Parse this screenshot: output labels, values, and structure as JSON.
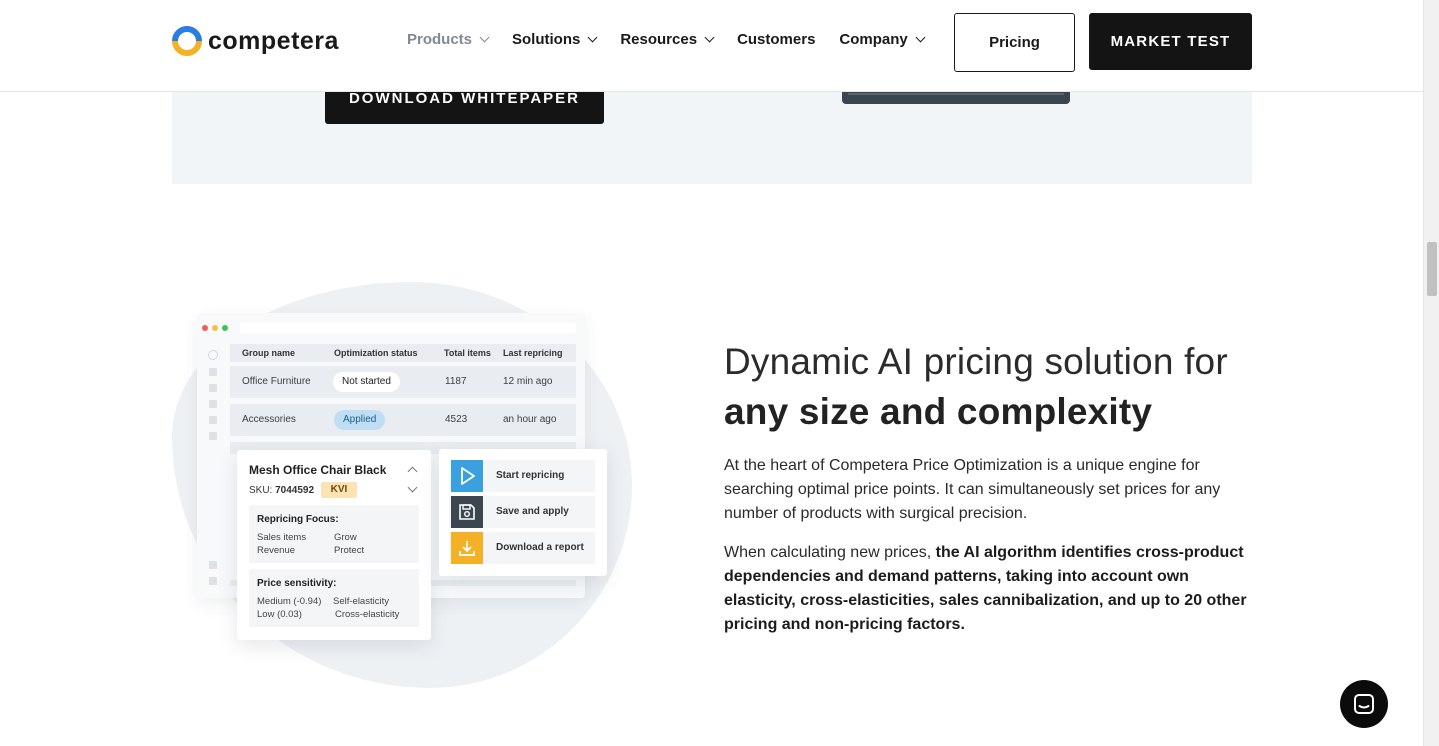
{
  "brand": {
    "name": "competera"
  },
  "nav": {
    "items": [
      {
        "label": "Products",
        "dropdown": true,
        "active": true
      },
      {
        "label": "Solutions",
        "dropdown": true
      },
      {
        "label": "Resources",
        "dropdown": true
      },
      {
        "label": "Customers",
        "dropdown": false
      },
      {
        "label": "Company",
        "dropdown": true
      }
    ],
    "pricing_label": "Pricing",
    "market_test_label": "MARKET TEST"
  },
  "band": {
    "whitepaper_label": "DOWNLOAD WHITEPAPER"
  },
  "illustration": {
    "table": {
      "headers": [
        "Group name",
        "Optimization status",
        "Total items",
        "Last repricing"
      ],
      "rows": [
        {
          "group": "Office Furniture",
          "status": "Not started",
          "items": "1187",
          "last": "12 min ago"
        },
        {
          "group": "Accessories",
          "status": "Applied",
          "items": "4523",
          "last": "an hour ago"
        }
      ]
    },
    "card": {
      "title": "Mesh Office Chair Black",
      "sku_label": "SKU:",
      "sku_value": "7044592",
      "badge": "KVI",
      "focus_title": "Repricing Focus:",
      "focus_left": [
        "Sales items",
        "Revenue"
      ],
      "focus_right": [
        "Grow",
        "Protect"
      ],
      "sens_title": "Price sensitivity:",
      "sens_left": [
        "Medium (-0.94)",
        "Low (0.03)"
      ],
      "sens_right": [
        "Self-elasticity",
        "Cross-elasticity"
      ]
    },
    "actions": [
      {
        "label": "Start repricing",
        "icon": "play-icon",
        "color": "#3aa0e0"
      },
      {
        "label": "Save and apply",
        "icon": "save-icon",
        "color": "#3c4650"
      },
      {
        "label": "Download a report",
        "icon": "download-icon",
        "color": "#f5b125"
      }
    ]
  },
  "section": {
    "headline_light": "Dynamic AI pricing solution for",
    "headline_bold": "any size and complexity",
    "para1": "At the heart of Competera Price Optimization is a unique engine for searching optimal price points. It can simultaneously set prices for any number of products with surgical precision.",
    "para2_prefix": "When calculating new prices, ",
    "para2_bold": "the AI algorithm identifies cross-product dependencies and demand patterns, taking into account own elasticity, cross-elasticities, sales cannibalization, and up to 20 other pricing and non-pricing factors."
  },
  "colors": {
    "accent_blue": "#2a7de1",
    "accent_yellow": "#f5b125",
    "dark": "#141414"
  }
}
